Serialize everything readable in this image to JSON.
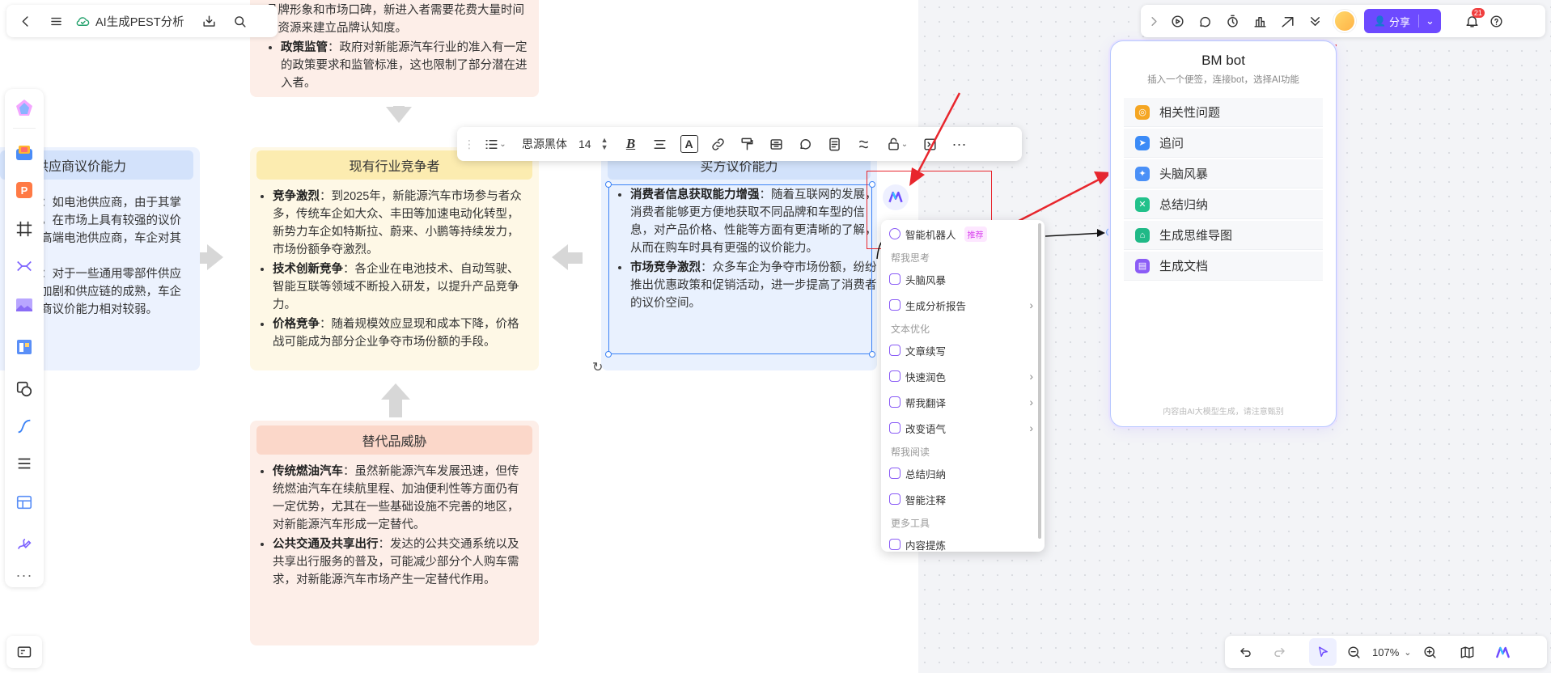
{
  "topbar": {
    "title": "AI生成PEST分析"
  },
  "cards": {
    "top": {
      "items": [
        {
          "text": "品牌形象和市场口碑，新进入者需要花费大量时间和资源来建立品牌认知度。"
        },
        {
          "bold": "政策监管",
          "text": "：政府对新能源汽车行业的准入有一定的政策要求和监管标准，这也限制了部分潜在进入者。"
        }
      ]
    },
    "left": {
      "title": "供应商议价能力",
      "lines": [
        "：如电池供应商，由于其掌",
        "，在市场上具有较强的议价",
        "高端电池供应商，车企对其",
        "：对于一些通用零部件供应",
        "加剧和供应链的成熟，车企",
        "商议价能力相对较弱。"
      ]
    },
    "center": {
      "title": "现有行业竞争者",
      "items": [
        {
          "bold": "竞争激烈",
          "text": "：到2025年，新能源汽车市场参与者众多，传统车企如大众、丰田等加速电动化转型，新势力车企如特斯拉、蔚来、小鹏等持续发力，市场份额争夺激烈。"
        },
        {
          "bold": "技术创新竞争",
          "text": "：各企业在电池技术、自动驾驶、智能互联等领域不断投入研发，以提升产品竞争力。"
        },
        {
          "bold": "价格竞争",
          "text": "：随着规模效应显现和成本下降，价格战可能成为部分企业争夺市场份额的手段。"
        }
      ]
    },
    "right": {
      "title": "买方议价能力",
      "items": [
        {
          "bold": "消费者信息获取能力增强",
          "text": "：随着互联网的发展，消费者能够更方便地获取不同品牌和车型的信息，对产品价格、性能等方面有更清晰的了解，从而在购车时具有更强的议价能力。"
        },
        {
          "bold": "市场竞争激烈",
          "text": "：众多车企为争夺市场份额，纷纷推出优惠政策和促销活动，进一步提高了消费者的议价空间。"
        }
      ]
    },
    "bottom": {
      "title": "替代品威胁",
      "items": [
        {
          "bold": "传统燃油汽车",
          "text": "：虽然新能源汽车发展迅速，但传统燃油汽车在续航里程、加油便利性等方面仍有一定优势，尤其在一些基础设施不完善的地区，对新能源汽车形成一定替代。"
        },
        {
          "bold": "公共交通及共享出行",
          "text": "：发达的公共交通系统以及共享出行服务的普及，可能减少部分个人购车需求，对新能源汽车市场产生一定替代作用。"
        }
      ]
    }
  },
  "format_toolbar": {
    "font": "思源黑体",
    "size": "14"
  },
  "ai_menu": {
    "top_item": "智能机器人",
    "badge": "推荐",
    "sections": [
      {
        "title": "帮我思考",
        "items": [
          {
            "label": "头脑风暴",
            "arrow": false
          },
          {
            "label": "生成分析报告",
            "arrow": true
          }
        ]
      },
      {
        "title": "文本优化",
        "items": [
          {
            "label": "文章续写",
            "arrow": false
          },
          {
            "label": "快速润色",
            "arrow": true
          },
          {
            "label": "帮我翻译",
            "arrow": true
          },
          {
            "label": "改变语气",
            "arrow": true
          }
        ]
      },
      {
        "title": "帮我阅读",
        "items": [
          {
            "label": "总结归纳",
            "arrow": false
          },
          {
            "label": "智能注释",
            "arrow": false
          }
        ]
      },
      {
        "title": "更多工具",
        "items": []
      }
    ],
    "cut_item": "内容提炼"
  },
  "bot": {
    "title": "BM bot",
    "subtitle": "插入一个便签，连接bot，选择AI功能",
    "items": [
      {
        "label": "相关性问题",
        "color": "#f5a623",
        "icon": "◎"
      },
      {
        "label": "追问",
        "color": "#3b8bf7",
        "icon": "➤"
      },
      {
        "label": "头脑风暴",
        "color": "#4a90f7",
        "icon": "✦"
      },
      {
        "label": "总结归纳",
        "color": "#22c18b",
        "icon": "✕"
      },
      {
        "label": "生成思维导图",
        "color": "#20b987",
        "icon": "⌂"
      },
      {
        "label": "生成文档",
        "color": "#8b5cf6",
        "icon": "▤"
      }
    ],
    "footer": "内容由AI大模型生成，请注意甄别"
  },
  "right_toolbar": {
    "share": "分享",
    "notif_count": "21"
  },
  "zoom": {
    "value": "107%"
  },
  "colors": {
    "accent": "#6d4aff",
    "red": "#e8262d",
    "selection": "#3b82f6"
  }
}
